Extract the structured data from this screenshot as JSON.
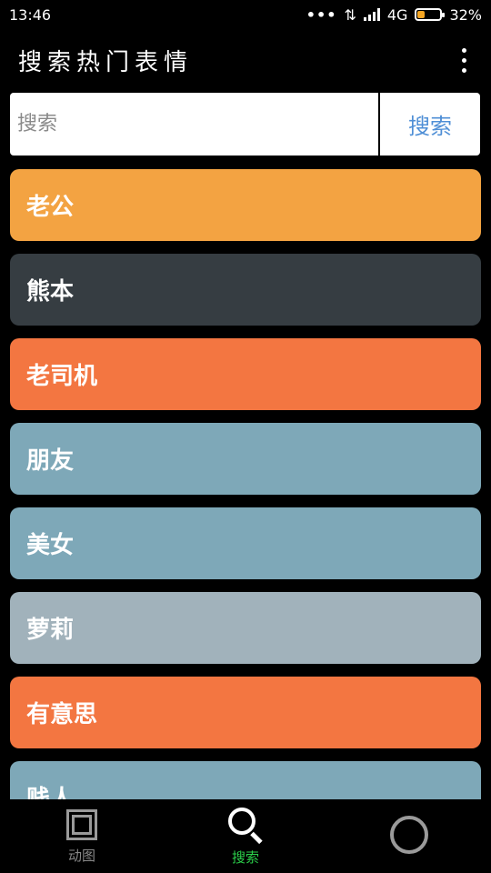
{
  "status_bar": {
    "time": "13:46",
    "network": "4G",
    "battery": "32%",
    "battery_level": 0.32
  },
  "app_bar": {
    "title": "搜索热门表情"
  },
  "search": {
    "placeholder": "搜索",
    "button_label": "搜索"
  },
  "tags": [
    {
      "label": "老公",
      "color": "#f3a342"
    },
    {
      "label": "熊本",
      "color": "#363d42"
    },
    {
      "label": "老司机",
      "color": "#f37641"
    },
    {
      "label": "朋友",
      "color": "#7ea8b8"
    },
    {
      "label": "美女",
      "color": "#7ea8b8"
    },
    {
      "label": "萝莉",
      "color": "#a1b2bb"
    },
    {
      "label": "有意思",
      "color": "#f37641"
    },
    {
      "label": "贱人",
      "color": "#7ea8b8"
    }
  ],
  "bottom_nav": {
    "items": [
      {
        "label": "动图",
        "icon": "frame-icon"
      },
      {
        "label": "搜索",
        "icon": "search-icon"
      },
      {
        "label": "",
        "icon": "circle-icon"
      }
    ]
  }
}
